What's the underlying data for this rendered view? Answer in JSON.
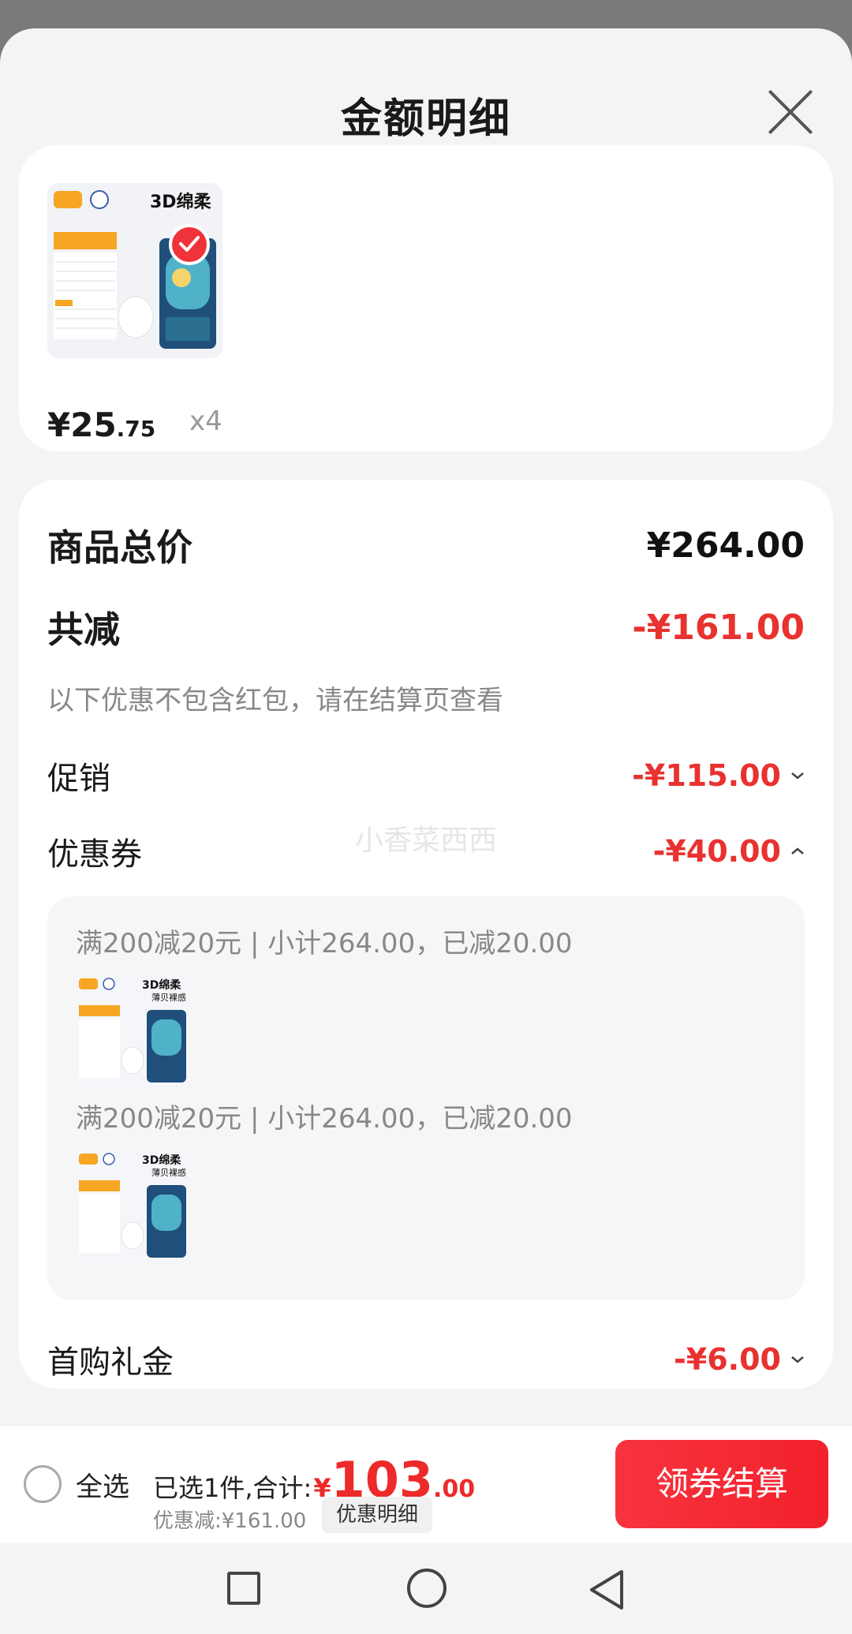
{
  "sheet": {
    "title": "金额明细",
    "close_icon": "close-icon"
  },
  "product": {
    "thumbnail": "diaper-product-image",
    "thumbnail_text": "3D绵柔",
    "price_main": "¥25",
    "price_decimal": ".75",
    "quantity": "x4",
    "selected": true
  },
  "details": {
    "total_label": "商品总价",
    "total_value": "¥264.00",
    "reduce_label": "共减",
    "reduce_value": "-¥161.00",
    "reduce_note": "以下优惠不包含红包，请在结算页查看",
    "promo_label": "促销",
    "promo_value": "-¥115.00",
    "coupon_label": "优惠券",
    "coupon_value": "-¥40.00",
    "coupons": [
      {
        "text": "满200减20元 | 小计264.00，已减20.00",
        "thumb_title": "3D绵柔",
        "thumb_subtitle": "薄贝裸感"
      },
      {
        "text": "满200减20元 | 小计264.00，已减20.00",
        "thumb_title": "3D绵柔",
        "thumb_subtitle": "薄贝裸感"
      }
    ],
    "first_label": "首购礼金",
    "first_value": "-¥6.00"
  },
  "watermark": "小香菜西西",
  "bottom": {
    "select_all": "全选",
    "selected_text": "已选1件,合计:",
    "total_yen": "¥",
    "total_int": "103",
    "total_dec": ".00",
    "discount_text": "优惠减:¥161.00",
    "detail_button": "优惠明细",
    "checkout_button": "领券结算"
  },
  "colors": {
    "accent_red": "#e8322f",
    "checkout_red": "#f2212c",
    "background": "#f4f4f4"
  }
}
